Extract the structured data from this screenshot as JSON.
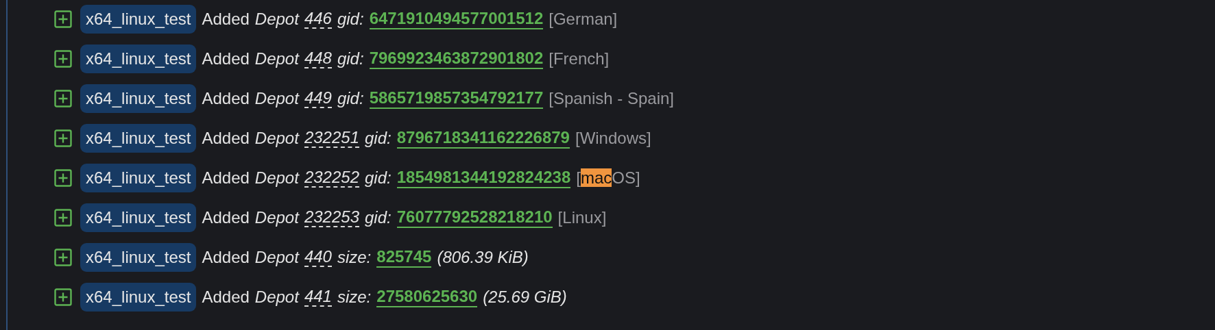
{
  "rows": [
    {
      "tag": "x64_linux_test",
      "action": "Added",
      "object": "Depot",
      "depot_id": "446",
      "kind": "gid",
      "field": "gid:",
      "value": "6471910494577001512",
      "note": [
        {
          "text": "[German]",
          "highlighted": false
        }
      ]
    },
    {
      "tag": "x64_linux_test",
      "action": "Added",
      "object": "Depot",
      "depot_id": "448",
      "kind": "gid",
      "field": "gid:",
      "value": "7969923463872901802",
      "note": [
        {
          "text": "[French]",
          "highlighted": false
        }
      ]
    },
    {
      "tag": "x64_linux_test",
      "action": "Added",
      "object": "Depot",
      "depot_id": "449",
      "kind": "gid",
      "field": "gid:",
      "value": "5865719857354792177",
      "note": [
        {
          "text": "[Spanish - Spain]",
          "highlighted": false
        }
      ]
    },
    {
      "tag": "x64_linux_test",
      "action": "Added",
      "object": "Depot",
      "depot_id": "232251",
      "kind": "gid",
      "field": "gid:",
      "value": "8796718341162226879",
      "note": [
        {
          "text": "[Windows]",
          "highlighted": false
        }
      ]
    },
    {
      "tag": "x64_linux_test",
      "action": "Added",
      "object": "Depot",
      "depot_id": "232252",
      "kind": "gid",
      "field": "gid:",
      "value": "1854981344192824238",
      "note": [
        {
          "text": "[",
          "highlighted": false
        },
        {
          "text": "mac",
          "highlighted": true
        },
        {
          "text": "OS]",
          "highlighted": false
        }
      ]
    },
    {
      "tag": "x64_linux_test",
      "action": "Added",
      "object": "Depot",
      "depot_id": "232253",
      "kind": "gid",
      "field": "gid:",
      "value": "76077792528218210",
      "note": [
        {
          "text": "[Linux]",
          "highlighted": false
        }
      ]
    },
    {
      "tag": "x64_linux_test",
      "action": "Added",
      "object": "Depot",
      "depot_id": "440",
      "kind": "size",
      "field": "size:",
      "value": "825745",
      "note": [
        {
          "text": "(806.39 KiB)",
          "highlighted": false
        }
      ]
    },
    {
      "tag": "x64_linux_test",
      "action": "Added",
      "object": "Depot",
      "depot_id": "441",
      "kind": "size",
      "field": "size:",
      "value": "27580625630",
      "note": [
        {
          "text": "(25.69 GiB)",
          "highlighted": false
        }
      ]
    }
  ]
}
